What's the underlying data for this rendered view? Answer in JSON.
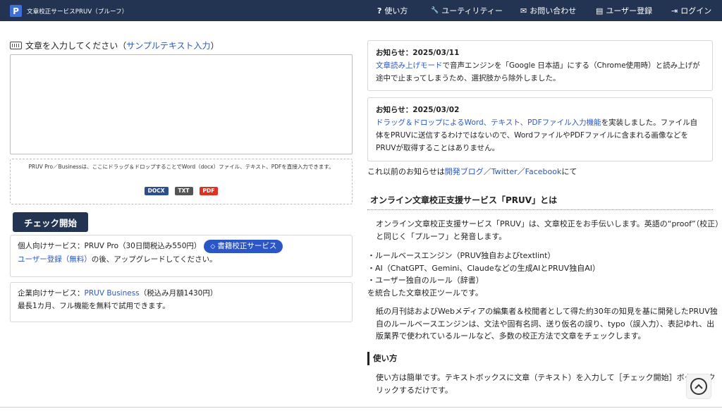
{
  "header": {
    "logo_letter": "P",
    "title": "文章校正サービスPRUV（プルーフ）",
    "nav": [
      {
        "icon": "help-icon",
        "glyph": "?",
        "label": "使い方"
      },
      {
        "icon": "wrench-icon",
        "glyph": "🔧",
        "label": "ユーティリティー"
      },
      {
        "icon": "contact-icon",
        "glyph": "✉",
        "label": "お問い合わせ"
      },
      {
        "icon": "register-icon",
        "glyph": "▤",
        "label": "ユーザー登録"
      },
      {
        "icon": "login-icon",
        "glyph": "⇥",
        "label": "ログイン"
      }
    ]
  },
  "input": {
    "label_prefix": "文章を入力してください（",
    "sample_link": "サンプルテキスト入力",
    "label_suffix": "）",
    "value": "",
    "drop_text": "PRUV Pro／Businessは、ここにドラッグ＆ドロップすることでWord（docx）ファイル、テキスト、PDFを直接入力できます。",
    "badges": [
      {
        "label": "DOCX",
        "color": "#2b4f8e"
      },
      {
        "label": "TXT",
        "color": "#555555"
      },
      {
        "label": "PDF",
        "color": "#e03020"
      }
    ],
    "check_button": "チェック開始"
  },
  "services": {
    "personal_prefix": "個人向けサービス：PRUV Pro（30日間税込み550円）",
    "book_button": "書籍校正サービス",
    "register_link": "ユーザー登録（無料）",
    "personal_suffix": "の後、アップグレードしてください。",
    "business_prefix": "企業向けサービス：",
    "business_link": "PRUV Business",
    "business_suffix": "（税込み月額1430円）",
    "business_note": "最長1カ月、フル機能を無料で試用できます。"
  },
  "notices": [
    {
      "title": "お知らせ：2025/03/11",
      "link": "文章読み上げモード",
      "text": "で音声エンジンを「Google 日本語」にする（Chrome使用時）と読み上げが途中で止まってしまうため、選択肢から除外しました。"
    },
    {
      "title": "お知らせ：2025/03/02",
      "link": "ドラッグ＆ドロップによるWord、テキスト、PDFファイル入力機能",
      "text": "を実装しました。ファイル自体をPRUVに送信するわけではないので、WordファイルやPDFファイルに含まれる画像などをPRUVが取得することはありません。"
    }
  ],
  "previous": {
    "prefix": "これ以前のお知らせは",
    "blog": "開発ブログ",
    "sep1": "／",
    "twitter": "Twitter",
    "sep2": "／",
    "facebook": "Facebook",
    "suffix": "にて"
  },
  "about": {
    "title": "オンライン文章校正支援サービス「PRUV」とは",
    "p1": "オンライン文章校正支援サービス「PRUV」は、文章校正をお手伝いします。英語の“proof”（校正）と同じく「プルーフ」と発音します。",
    "list": [
      "・ルールベースエンジン（PRUV独自およびtextlint）",
      "・AI（ChatGPT、Gemini、Claudeなどの生成AIとPRUV独自AI）",
      "・ユーザー独自のルール（辞書）"
    ],
    "list_after": "を統合した文章校正ツールです。",
    "p2": "紙の月刊誌およびWebメディアの編集者＆校閲者として得た約30年の知見を基に開発したPRUV独自のルールベースエンジンは、文法や固有名詞、送り仮名の誤り、typo（誤入力）、表記ゆれ、出版業界で使われているルールなど、多数の校正方法で文章をチェックします。",
    "usage_title": "使い方",
    "usage_text": "使い方は簡単です。テキストボックスに文章（テキスト）を入力して［チェック開始］ボタンをクリックするだけです。"
  },
  "scroll_top_icon": "scroll-up-icon"
}
